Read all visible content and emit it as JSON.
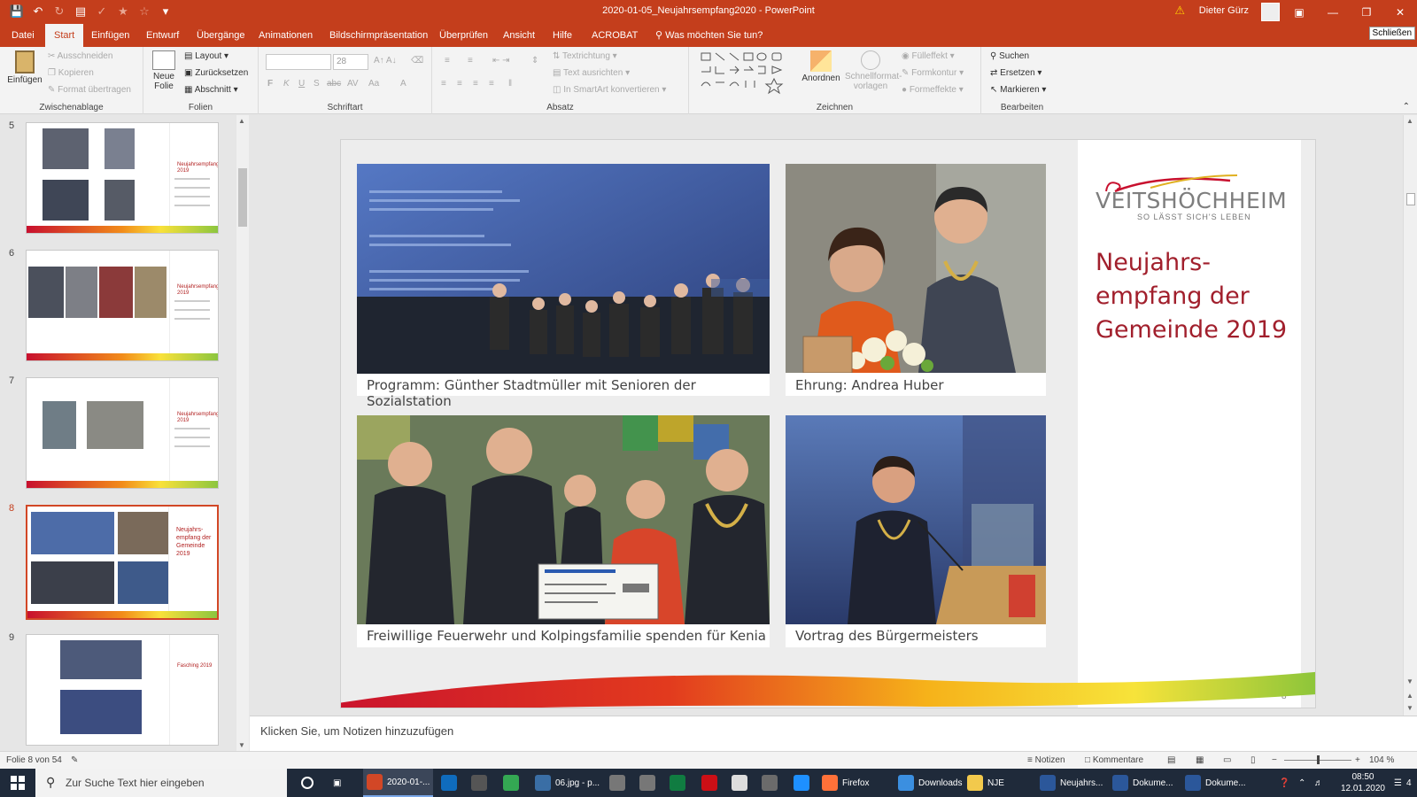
{
  "titlebar": {
    "doc_title": "2020-01-05_Neujahrsempfang2020 - PowerPoint",
    "user": "Dieter Gürz"
  },
  "menu": {
    "tabs": [
      "Datei",
      "Start",
      "Einfügen",
      "Entwurf",
      "Übergänge",
      "Animationen",
      "Bildschirmpräsentation",
      "Überprüfen",
      "Ansicht",
      "Hilfe",
      "ACROBAT"
    ],
    "tell_me": "Was möchten Sie tun?",
    "close_label": "Schließen"
  },
  "ribbon": {
    "clipboard": {
      "label": "Zwischenablage",
      "paste": "Einfügen",
      "cut": "Ausschneiden",
      "copy": "Kopieren",
      "format_painter": "Format übertragen"
    },
    "slides": {
      "label": "Folien",
      "new_slide": "Neue Folie",
      "layout": "Layout",
      "reset": "Zurücksetzen",
      "section": "Abschnitt"
    },
    "font": {
      "label": "Schriftart",
      "size": "28"
    },
    "paragraph": {
      "label": "Absatz",
      "text_direction": "Textrichtung",
      "align_text": "Text ausrichten",
      "smartart": "In SmartArt konvertieren"
    },
    "drawing": {
      "label": "Zeichnen",
      "arrange": "Anordnen",
      "quick_styles": "Schnellformat-vorlagen",
      "fill": "Fülleffekt",
      "outline": "Formkontur",
      "effects": "Formeffekte"
    },
    "editing": {
      "label": "Bearbeiten",
      "find": "Suchen",
      "replace": "Ersetzen",
      "select": "Markieren"
    }
  },
  "thumbnails": [
    {
      "num": "5",
      "title": "Neujahrsempfang 2019"
    },
    {
      "num": "6",
      "title": "Neujahrsempfang 2019"
    },
    {
      "num": "7",
      "title": "Neujahrsempfang 2019"
    },
    {
      "num": "8",
      "title": "Neujahrs-empfang der Gemeinde 2019",
      "selected": true
    },
    {
      "num": "9",
      "title": "Fasching 2019"
    }
  ],
  "slide": {
    "logo": "VEITSHÖCHHEIM",
    "logo_sub": "SO LÄSST SICH'S LEBEN",
    "title": "Neujahrs-empfang der Gemeinde 2019",
    "number": "8",
    "photos": [
      {
        "caption": "Programm: Günther Stadtmüller mit Senioren der Sozialstation"
      },
      {
        "caption": "Ehrung: Andrea Huber"
      },
      {
        "caption": "Freiwillige Feuerwehr und  Kolpingsfamilie spenden für Kenia"
      },
      {
        "caption": "Vortrag des Bürgermeisters"
      }
    ]
  },
  "notes": {
    "placeholder": "Klicken Sie, um Notizen hinzuzufügen"
  },
  "statusbar": {
    "slide_of": "Folie 8 von 54",
    "notes": "Notizen",
    "comments": "Kommentare",
    "zoom": "104 %"
  },
  "taskbar": {
    "search": "Zur Suche Text hier eingeben",
    "apps": [
      {
        "label": "2020-01-...",
        "color": "#d24726"
      },
      {
        "label": "",
        "color": "#0f6cbd"
      },
      {
        "label": "",
        "color": "#555555"
      },
      {
        "label": "",
        "color": "#34a853"
      },
      {
        "label": "06.jpg - p...",
        "color": "#3a6ea5"
      },
      {
        "label": "",
        "color": "#777777"
      },
      {
        "label": "",
        "color": "#777777"
      },
      {
        "label": "",
        "color": "#107c41"
      },
      {
        "label": "",
        "color": "#cc0f16"
      },
      {
        "label": "",
        "color": "#dddddd"
      },
      {
        "label": "",
        "color": "#6b6b6b"
      },
      {
        "label": "",
        "color": "#1e90ff"
      },
      {
        "label": "Firefox",
        "color": "#ff7139"
      },
      {
        "label": "Downloads",
        "color": "#3b8fe0"
      },
      {
        "label": "NJE",
        "color": "#f2c94c"
      },
      {
        "label": "Neujahrs...",
        "color": "#2b579a"
      },
      {
        "label": "Dokume...",
        "color": "#2b579a"
      },
      {
        "label": "Dokume...",
        "color": "#2b579a"
      }
    ],
    "time": "08:50",
    "date": "12.01.2020",
    "notifications": "4"
  }
}
